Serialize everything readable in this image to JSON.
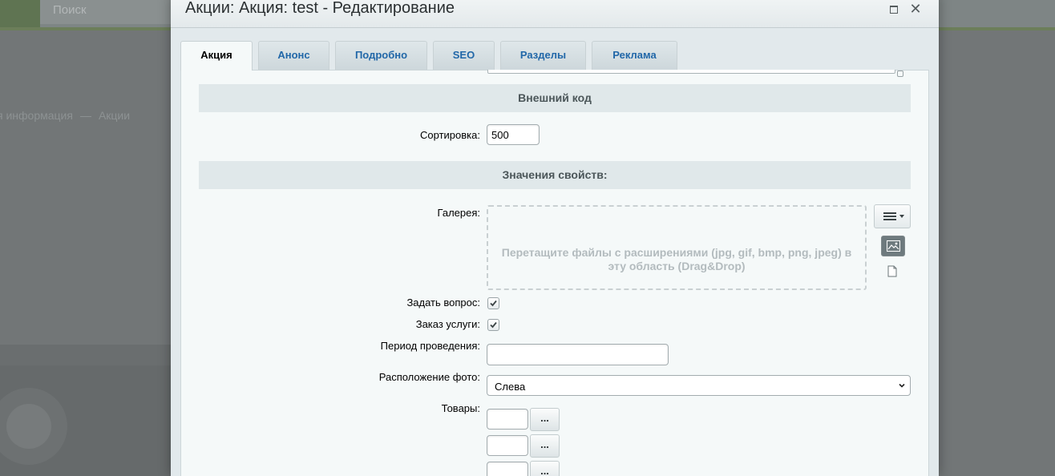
{
  "background": {
    "search_placeholder": "Поиск",
    "breadcrumb": [
      "я информация",
      "Акции"
    ],
    "breadcrumb_separator": "—"
  },
  "dialog": {
    "title": "Акции: Акция: test - Редактирование",
    "maximize_icon": "maximize-icon",
    "close_icon": "close-icon",
    "close_symbol": "✕"
  },
  "tabs": [
    {
      "label": "Акция",
      "active": true
    },
    {
      "label": "Анонс",
      "active": false
    },
    {
      "label": "Подробно",
      "active": false
    },
    {
      "label": "SEO",
      "active": false
    },
    {
      "label": "Разделы",
      "active": false
    },
    {
      "label": "Реклама",
      "active": false
    }
  ],
  "form": {
    "section_external": "Внешний код",
    "sort_label": "Сортировка:",
    "sort_value": "500",
    "section_properties": "Значения свойств:",
    "gallery_label": "Галерея:",
    "gallery_dropzone": "Перетащите файлы с расширениями (jpg, gif, bmp, png, jpeg) в эту область (Drag&Drop)",
    "ask_question_label": "Задать вопрос:",
    "ask_question_checked": true,
    "order_service_label": "Заказ услуги:",
    "order_service_checked": true,
    "period_label": "Период проведения:",
    "period_value": "",
    "photo_position_label": "Расположение фото:",
    "photo_position_value": "Слева",
    "products_label": "Товары:",
    "products_button": "..."
  },
  "colors": {
    "tab_link": "#2167a8",
    "section_bg": "#e0e8ea",
    "panel_bg": "#f5f9f9"
  }
}
